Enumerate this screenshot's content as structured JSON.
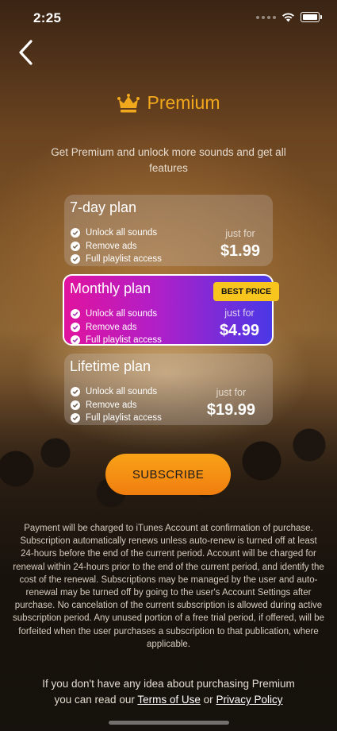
{
  "status_bar": {
    "time": "2:25"
  },
  "header": {
    "title": "Premium",
    "subtitle": "Get Premium and unlock more sounds and get all features"
  },
  "plans": [
    {
      "name": "7-day plan",
      "features": [
        "Unlock all sounds",
        "Remove ads",
        "Full playlist access"
      ],
      "price_prefix": "just for",
      "price": "$1.99"
    },
    {
      "name": "Monthly plan",
      "badge": "BEST PRICE",
      "selected": true,
      "features": [
        "Unlock all sounds",
        "Remove ads",
        "Full playlist access"
      ],
      "price_prefix": "just for",
      "price": "$4.99"
    },
    {
      "name": "Lifetime plan",
      "features": [
        "Unlock all sounds",
        "Remove ads",
        "Full playlist access"
      ],
      "price_prefix": "just for",
      "price": "$19.99"
    }
  ],
  "subscribe_label": "SUBSCRIBE",
  "terms": "Payment will be charged to iTunes Account at confirmation of purchase. Subscription automatically renews unless auto-renew is turned off at least 24-hours before the end of the current period. Account will be charged for renewal within 24-hours prior to the end of the current period, and identify the cost of the renewal. Subscriptions may be managed by the user and auto-renewal may be turned off by going to the user's Account Settings after purchase. No cancelation of the current subscription is allowed during active subscription period. Any unused portion of a free trial period, if offered, will be forfeited when the user purchases a subscription to that publication, where applicable.",
  "footer": {
    "line1": "If you don't have any idea about purchasing Premium",
    "line2_prefix": "you can read our",
    "terms_link": "Terms of Use",
    "conjunction": "or",
    "privacy_link": "Privacy Policy"
  },
  "colors": {
    "accent": "#f2a81d",
    "subscribe": "#f7941d",
    "badge": "#f7c51d",
    "selected_gradient_start": "#e0139e",
    "selected_gradient_end": "#4a38e6"
  },
  "icons": [
    "back-chevron-icon",
    "crown-icon",
    "check-circle-icon",
    "wifi-icon",
    "battery-icon",
    "signal-dots-icon"
  ]
}
